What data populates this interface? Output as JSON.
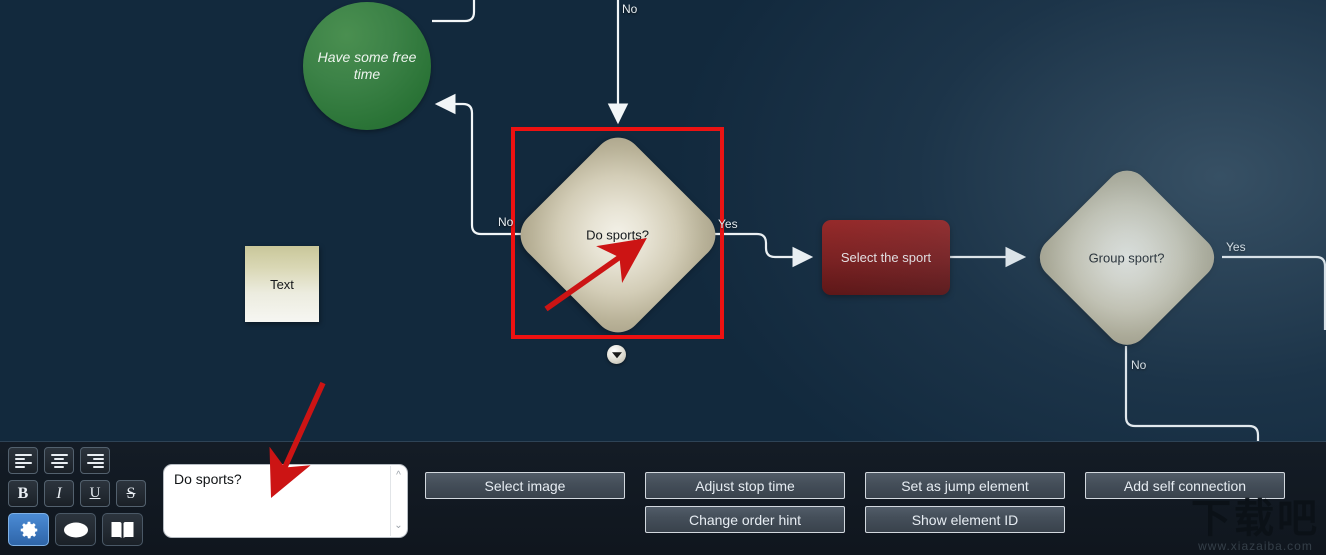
{
  "canvas": {
    "background_color": "#12293d",
    "nodes": [
      {
        "id": "free-time",
        "type": "circle",
        "label": "Have some free time",
        "color": "#2f7a3a"
      },
      {
        "id": "text-note",
        "type": "note",
        "label": "Text",
        "color": "#d9d7b4"
      },
      {
        "id": "do-sports",
        "type": "diamond",
        "label": "Do sports?",
        "color": "#e7e3d4",
        "selected": true
      },
      {
        "id": "select-sport",
        "type": "rect",
        "label": "Select the sport",
        "color": "#8e1f1d"
      },
      {
        "id": "group-sport",
        "type": "diamond",
        "label": "Group sport?",
        "color": "#e7e3d4",
        "selected": false
      }
    ],
    "edge_labels": [
      {
        "id": "top-no",
        "text": "No"
      },
      {
        "id": "do-sports-no",
        "text": "No"
      },
      {
        "id": "do-sports-yes",
        "text": "Yes"
      },
      {
        "id": "group-sport-yes",
        "text": "Yes"
      },
      {
        "id": "group-sport-no",
        "text": "No"
      }
    ],
    "selection": {
      "color": "#ee1111"
    },
    "collapse_handle": {
      "icon": "chevron-down-icon"
    }
  },
  "annotations": {
    "arrow_color": "#cc1414",
    "arrows": [
      {
        "id": "arrow-to-diamond",
        "points_to": "do-sports"
      },
      {
        "id": "arrow-to-textarea",
        "points_to": "text-editor"
      }
    ]
  },
  "panel": {
    "toolbar": {
      "rows": [
        [
          {
            "name": "align-left-icon",
            "label": "Align left",
            "active": false
          },
          {
            "name": "align-center-icon",
            "label": "Align center",
            "active": false
          },
          {
            "name": "align-right-icon",
            "label": "Align right",
            "active": false
          }
        ],
        [
          {
            "name": "bold-icon",
            "label": "B",
            "active": false
          },
          {
            "name": "italic-icon",
            "label": "I",
            "active": false
          },
          {
            "name": "underline-icon",
            "label": "U",
            "active": false
          },
          {
            "name": "strikethrough-icon",
            "label": "S",
            "active": false
          }
        ],
        [
          {
            "name": "gear-icon",
            "label": "⚙",
            "active": true
          },
          {
            "name": "ellipse-icon",
            "label": "⬭",
            "active": false
          },
          {
            "name": "book-icon",
            "label": "📖",
            "active": false
          }
        ]
      ]
    },
    "text_editor": {
      "value": "Do sports?",
      "placeholder": "",
      "scroll_up_icon": "chevron-up-icon",
      "scroll_down_icon": "chevron-down-icon"
    },
    "buttons": [
      {
        "id": "select-image",
        "label": "Select image"
      },
      {
        "id": "adjust-stop-time",
        "label": "Adjust stop time"
      },
      {
        "id": "set-as-jump-element",
        "label": "Set as jump element"
      },
      {
        "id": "add-self-connection",
        "label": "Add self connection"
      },
      {
        "id": "change-order-hint",
        "label": "Change order hint"
      },
      {
        "id": "show-element-id",
        "label": "Show element ID"
      }
    ]
  },
  "watermark": {
    "logo_text": "下载吧",
    "url": "www.xiazaiba.com"
  }
}
